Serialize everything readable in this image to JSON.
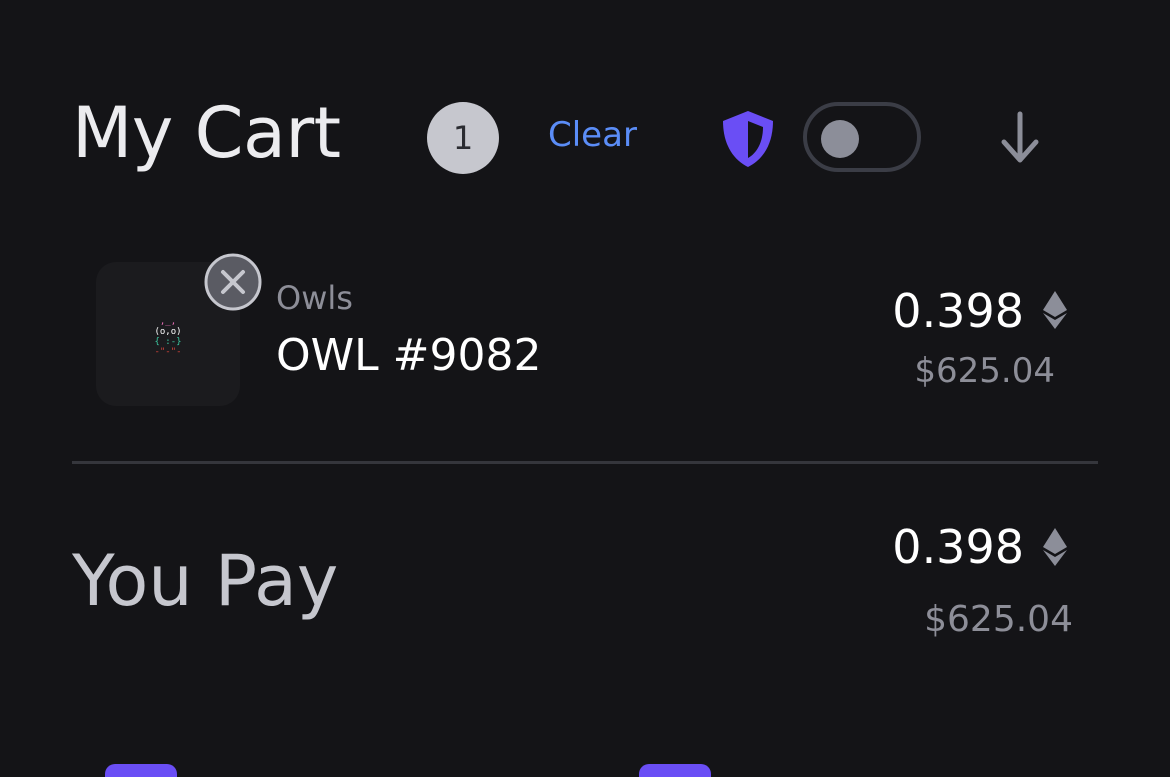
{
  "header": {
    "title": "My Cart",
    "item_count": "1",
    "clear_label": "Clear",
    "protection_toggle": {
      "on": false
    },
    "icons": [
      "shield-icon",
      "toggle",
      "arrow-down-icon"
    ]
  },
  "cart": {
    "items": [
      {
        "collection": "Owls",
        "name": "OWL #9082",
        "price_eth": "0.398",
        "price_usd": "$625.04"
      }
    ]
  },
  "totals": {
    "label": "You Pay",
    "price_eth": "0.398",
    "price_usd": "$625.04"
  },
  "colors": {
    "background": "#141417",
    "accent_blue": "#5B8DF7",
    "accent_purple": "#6A4EF5",
    "muted_text": "#8D8E98"
  }
}
